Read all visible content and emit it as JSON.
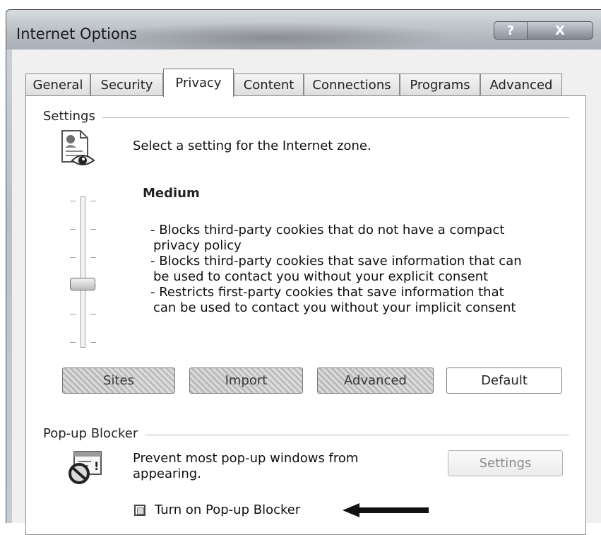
{
  "window": {
    "title": "Internet Options",
    "help_label": "?",
    "close_label": "X"
  },
  "tabs": [
    {
      "label": "General"
    },
    {
      "label": "Security"
    },
    {
      "label": "Privacy"
    },
    {
      "label": "Content"
    },
    {
      "label": "Connections"
    },
    {
      "label": "Programs"
    },
    {
      "label": "Advanced"
    }
  ],
  "active_tab": "Privacy",
  "settings": {
    "group_label": "Settings",
    "zone_text": "Select a setting for the Internet zone.",
    "level": "Medium",
    "description": [
      "- Blocks third-party cookies that do not have a compact",
      "privacy policy",
      "- Blocks third-party cookies that save information that can",
      "be used to contact you without your explicit consent",
      "- Restricts first-party cookies that save information that",
      "can be used to contact you without your implicit consent"
    ],
    "buttons": {
      "sites": "Sites",
      "import": "Import",
      "advanced": "Advanced",
      "default": "Default"
    }
  },
  "popup": {
    "group_label": "Pop-up Blocker",
    "text_line1": "Prevent most pop-up windows from",
    "text_line2": "appearing.",
    "settings_label": "Settings",
    "checkbox_label": "Turn on Pop-up Blocker"
  },
  "icons": [
    "privacy-document-eye-icon",
    "popup-blocked-icon",
    "left-arrow-icon"
  ],
  "colors": {
    "panel_bg": "#ffffff",
    "dialog_bg": "#f0f0f0",
    "disabled_text": "#8a8a8a"
  }
}
